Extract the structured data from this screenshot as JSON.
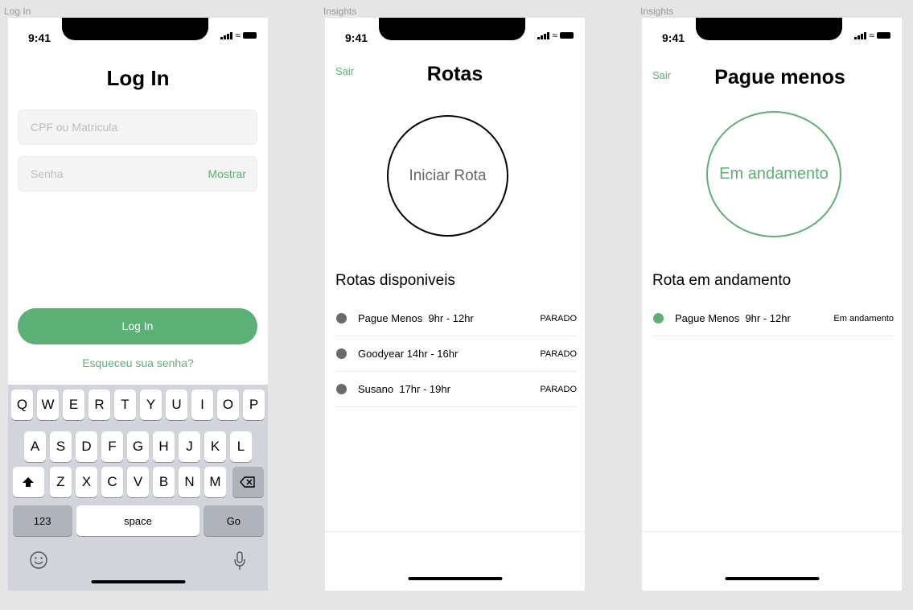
{
  "frames": {
    "login": "Log In",
    "rotas": "Insights",
    "pague": "Insights"
  },
  "status_time": "9:41",
  "login": {
    "title": "Log In",
    "cpf_placeholder": "CPF ou Matricula",
    "senha_placeholder": "Senha",
    "show_label": "Mostrar",
    "button": "Log In",
    "forgot": "Esqueceu sua senha?"
  },
  "keyboard": {
    "row1": [
      "Q",
      "W",
      "E",
      "R",
      "T",
      "Y",
      "U",
      "I",
      "O",
      "P"
    ],
    "row2": [
      "A",
      "S",
      "D",
      "F",
      "G",
      "H",
      "J",
      "K",
      "L"
    ],
    "row3": [
      "Z",
      "X",
      "C",
      "V",
      "B",
      "N",
      "M"
    ],
    "num": "123",
    "space": "space",
    "go": "Go",
    "icons": [
      "shift-icon",
      "backspace-icon",
      "emoji-icon",
      "microphone-icon"
    ]
  },
  "rotas": {
    "back": "Sair",
    "title": "Rotas",
    "circle": "Iniciar Rota",
    "section": "Rotas disponiveis",
    "items": [
      {
        "name": "Pague Menos  9hr - 12hr",
        "status": "PARADO"
      },
      {
        "name": "Goodyear 14hr - 16hr",
        "status": "PARADO"
      },
      {
        "name": "Susano  17hr - 19hr",
        "status": "PARADO"
      }
    ]
  },
  "pague": {
    "back": "Sair",
    "title": "Pague menos",
    "circle": "Em andamento",
    "section": "Rota em andamento",
    "items": [
      {
        "name": "Pague Menos  9hr - 12hr",
        "status": "Em andamento"
      }
    ]
  },
  "colors": {
    "accent": "#5db075",
    "background": "#e5e5e5",
    "keyboard": "#d1d4da"
  }
}
